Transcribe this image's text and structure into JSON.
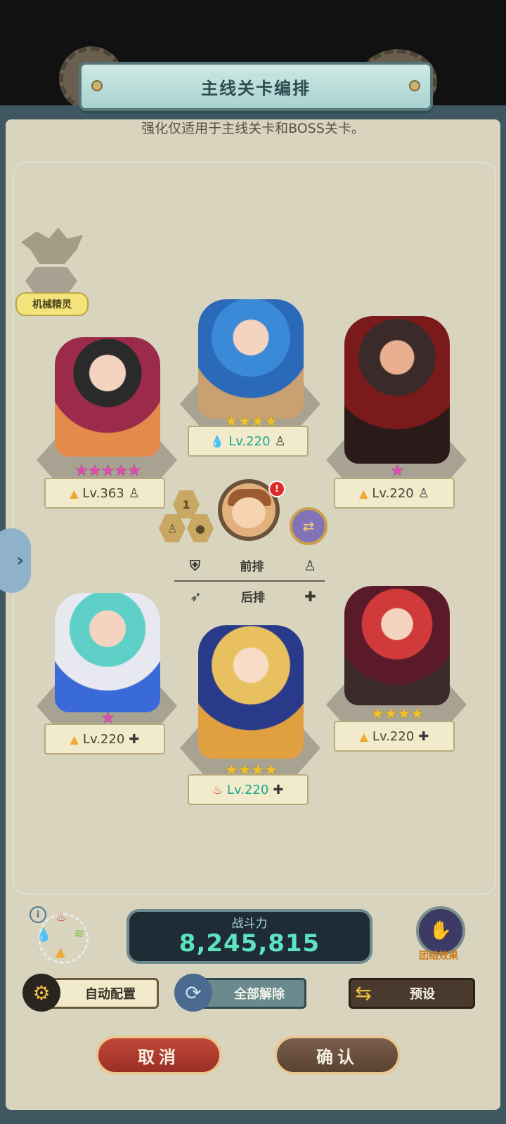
{
  "header": {
    "title": "主线关卡编排"
  },
  "subtitle": "强化仅适用于主线关卡和BOSS关卡。",
  "spirit": {
    "label": "机械精灵"
  },
  "heroes": [
    {
      "id": "front-left",
      "stars": "★★★★★",
      "star_color": "pink",
      "element": "fire",
      "element_glyph": "▲",
      "level": "Lv.363",
      "position_glyph": "♙"
    },
    {
      "id": "front-center",
      "stars": "★★★★",
      "star_color": "gold",
      "element": "water",
      "element_glyph": "💧",
      "level": "Lv.220",
      "position_glyph": "♙"
    },
    {
      "id": "front-right",
      "stars": "★",
      "star_color": "pink",
      "element": "fire",
      "element_glyph": "▲",
      "level": "Lv.220",
      "position_glyph": "♙"
    },
    {
      "id": "back-left",
      "stars": "★",
      "star_color": "pink",
      "element": "fire",
      "element_glyph": "▲",
      "level": "Lv.220",
      "position_glyph": "✚"
    },
    {
      "id": "back-center",
      "stars": "★★★★",
      "star_color": "gold",
      "element": "fire",
      "element_glyph": "♨",
      "level": "Lv.220",
      "position_glyph": "✚"
    },
    {
      "id": "back-right",
      "stars": "★★★★",
      "star_color": "gold",
      "element": "fire",
      "element_glyph": "▲",
      "level": "Lv.220",
      "position_glyph": "✚"
    }
  ],
  "leader": {
    "alert": "!",
    "slot_number": "1"
  },
  "rows": {
    "front": "前排",
    "back": "后排"
  },
  "power": {
    "label": "战斗力",
    "value": "8,245,815"
  },
  "bond": {
    "label": "团结效果"
  },
  "actions": {
    "auto": "自动配置",
    "clear_all": "全部解除",
    "preset": "预设"
  },
  "footer": {
    "cancel": "取消",
    "confirm": "确认"
  },
  "colors": {
    "frame": "#3e5760",
    "panel": "#d8d4bd",
    "power_value": "#5ce3c2",
    "cancel": "#b23c30",
    "confirm": "#6a4e3c"
  }
}
